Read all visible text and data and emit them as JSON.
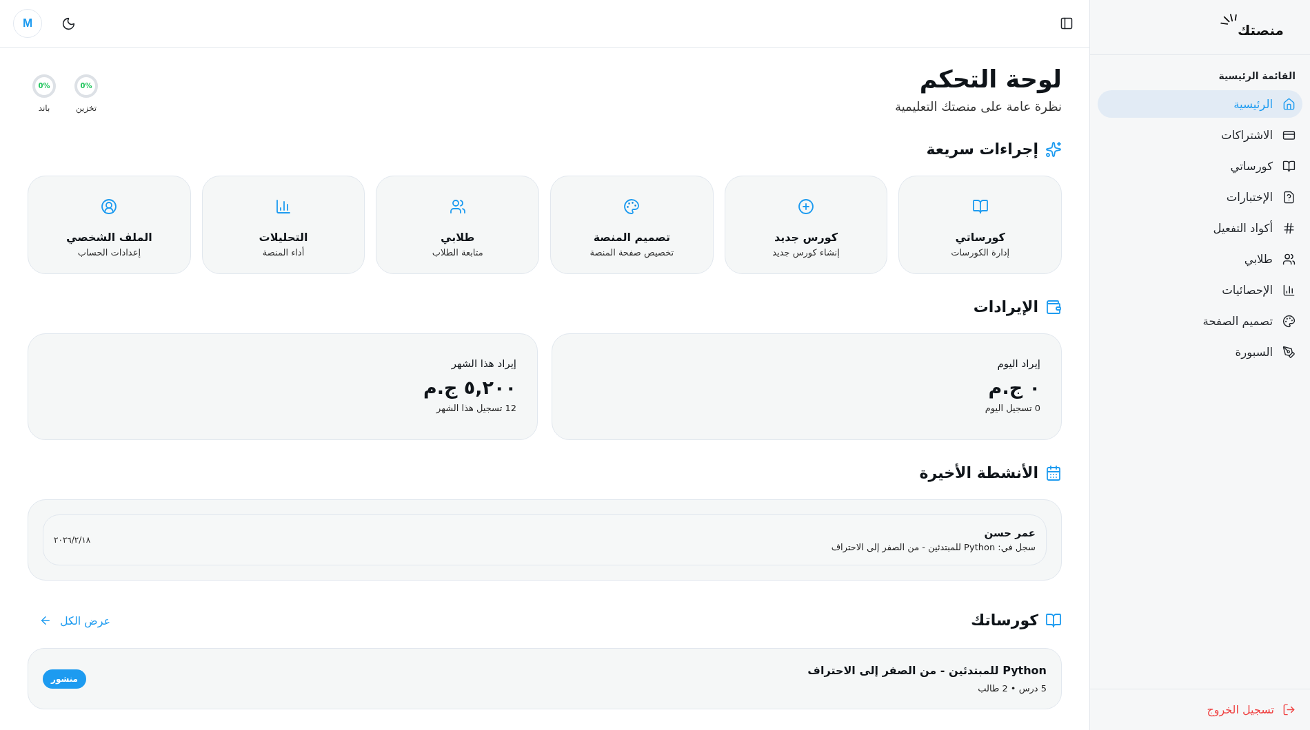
{
  "header": {
    "avatar": "M"
  },
  "sidebar": {
    "logo": "منصتك",
    "section_title": "القائمة الرئيسية",
    "items": [
      {
        "label": "الرئيسية",
        "selected": true
      },
      {
        "label": "الاشتراكات",
        "selected": false
      },
      {
        "label": "كورساتي",
        "selected": false
      },
      {
        "label": "الإختبارات",
        "selected": false
      },
      {
        "label": "أكواد التفعيل",
        "selected": false
      },
      {
        "label": "طلابي",
        "selected": false
      },
      {
        "label": "الإحصائيات",
        "selected": false
      },
      {
        "label": "تصميم الصفحة",
        "selected": false
      },
      {
        "label": "السبورة",
        "selected": false
      }
    ],
    "logout": "تسجيل الخروج"
  },
  "page": {
    "title": "لوحة التحكم",
    "subtitle": "نظرة عامة على منصتك التعليمية"
  },
  "usage": [
    {
      "label": "تخزين",
      "reading": "0%",
      "level": 0
    },
    {
      "label": "باند",
      "reading": "0%",
      "level": 0
    }
  ],
  "quick_actions": {
    "title": "إجراءات سريعة",
    "items": [
      {
        "title": "كورساتي",
        "subtitle": "إدارة الكورسات"
      },
      {
        "title": "كورس جديد",
        "subtitle": "إنشاء كورس جديد"
      },
      {
        "title": "تصميم المنصة",
        "subtitle": "تخصيص صفحة المنصة"
      },
      {
        "title": "طلابي",
        "subtitle": "متابعة الطلاب"
      },
      {
        "title": "التحليلات",
        "subtitle": "أداء المنصة"
      },
      {
        "title": "الملف الشخصي",
        "subtitle": "إعدادات الحساب"
      }
    ]
  },
  "revenue": {
    "title": "الإيرادات",
    "cards": [
      {
        "label": "إيراد اليوم",
        "value": "٠ ج.م",
        "note": "0 تسجيل اليوم"
      },
      {
        "label": "إيراد هذا الشهر",
        "value": "٥,٢٠٠ ج.م",
        "note": "12 تسجيل هذا الشهر"
      }
    ]
  },
  "recent_activity": {
    "title": "الأنشطة الأخيرة",
    "items": [
      {
        "name": "عمر حسن",
        "detail": "سجل في: Python للمبتدئين - من الصفر إلى الاحتراف",
        "date": "٢٠٢٦/٢/١٨"
      }
    ]
  },
  "courses": {
    "title": "كورساتك",
    "view_all": "عرض الكل",
    "items": [
      {
        "title": "Python للمبتدئين - من الصفر إلى الاحتراف",
        "meta": "5 درس • 2 طالب",
        "status": "منشور"
      }
    ]
  }
}
